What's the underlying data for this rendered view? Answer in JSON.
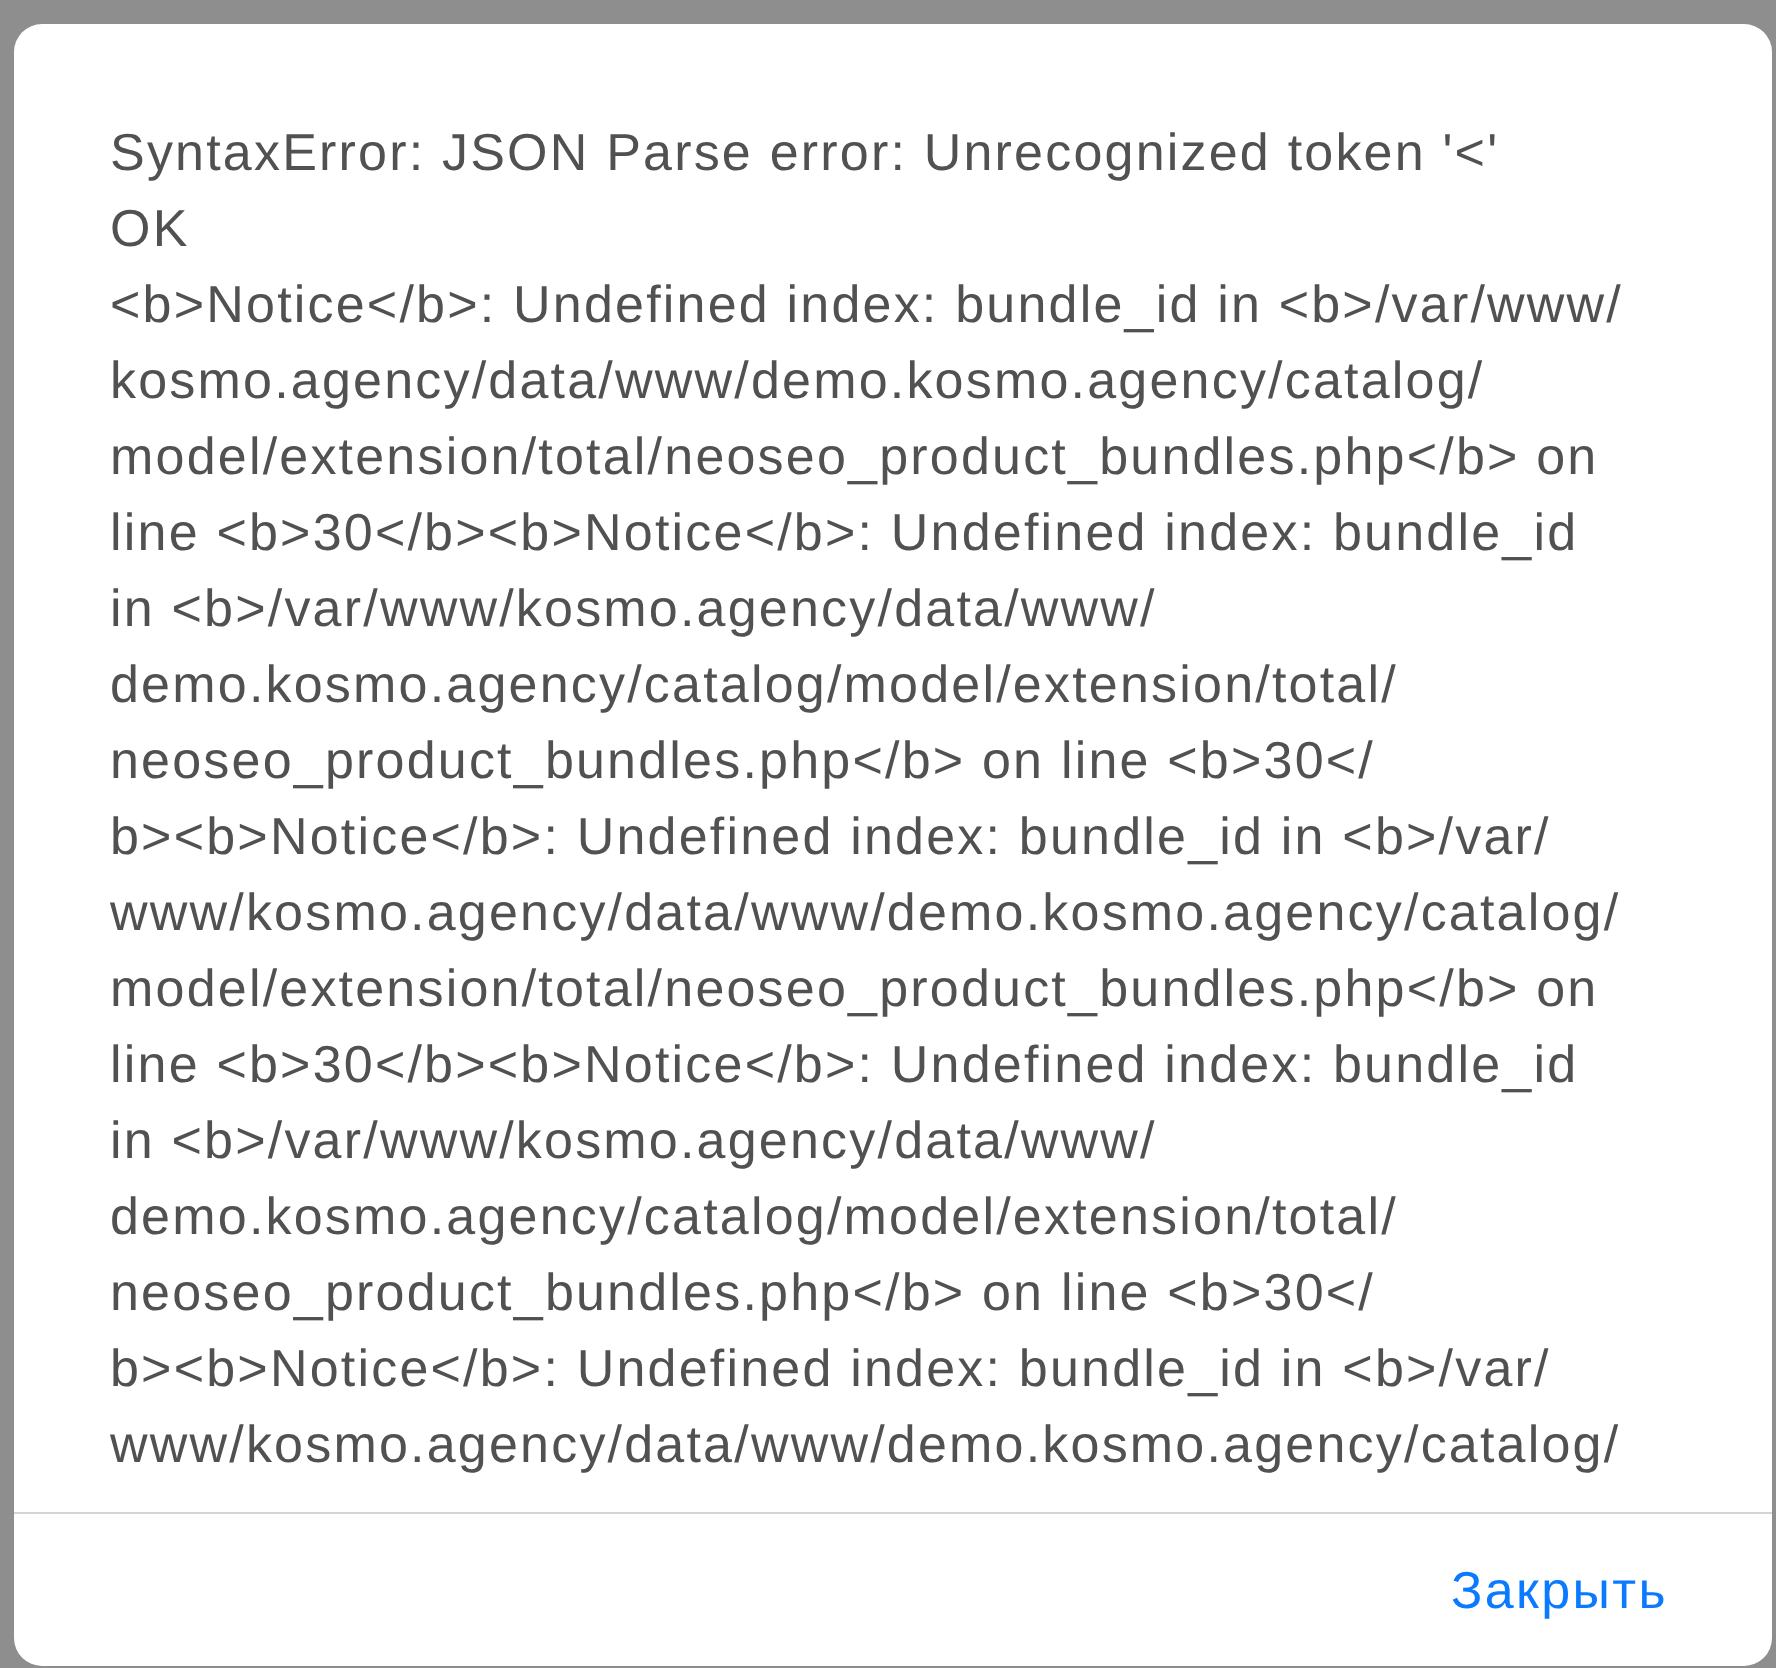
{
  "dialog": {
    "message": [
      {
        "lines": [
          "SyntaxError: JSON Parse error: Unrecognized token '<'"
        ]
      },
      {
        "lines": [
          "OK"
        ]
      },
      {
        "lines": [
          "<b>Notice</b>: Undefined index: bundle_id in <b>/var/www/",
          "kosmo.agency/data/www/demo.kosmo.agency/catalog/",
          "model/extension/total/neoseo_product_bundles.php</b> on",
          "line <b>30</b><b>Notice</b>: Undefined index: bundle_id",
          "in <b>/var/www/kosmo.agency/data/www/",
          "demo.kosmo.agency/catalog/model/extension/total/",
          "neoseo_product_bundles.php</b> on line <b>30</",
          "b><b>Notice</b>: Undefined index: bundle_id in <b>/var/",
          "www/kosmo.agency/data/www/demo.kosmo.agency/catalog/",
          "model/extension/total/neoseo_product_bundles.php</b> on",
          "line <b>30</b><b>Notice</b>: Undefined index: bundle_id",
          "in <b>/var/www/kosmo.agency/data/www/",
          "demo.kosmo.agency/catalog/model/extension/total/",
          "neoseo_product_bundles.php</b> on line <b>30</",
          "b><b>Notice</b>: Undefined index: bundle_id in <b>/var/",
          "www/kosmo.agency/data/www/demo.kosmo.agency/catalog/"
        ]
      }
    ],
    "buttons": [
      {
        "label": "Закрыть"
      }
    ]
  }
}
